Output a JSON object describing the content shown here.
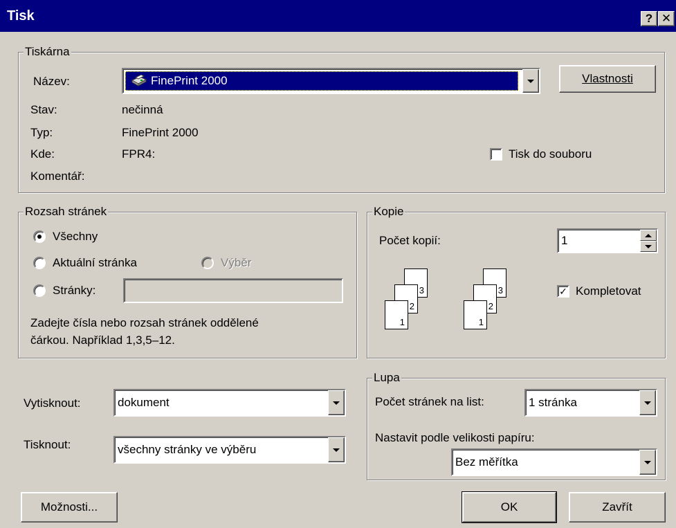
{
  "window": {
    "title": "Tisk",
    "help_button": "?",
    "close_button": "✕"
  },
  "printer": {
    "group_label": "Tiskárna",
    "name_label": "Název:",
    "name_value": "FinePrint 2000",
    "properties_button": "Vlastnosti",
    "status_label": "Stav:",
    "status_value": "nečinná",
    "type_label": "Typ:",
    "type_value": "FinePrint 2000",
    "where_label": "Kde:",
    "where_value": "FPR4:",
    "comment_label": "Komentář:",
    "print_to_file_label": "Tisk do souboru",
    "print_to_file_checked": false
  },
  "range": {
    "group_label": "Rozsah stránek",
    "all_label": "Všechny",
    "current_label": "Aktuální stránka",
    "selection_label": "Výběr",
    "pages_label": "Stránky:",
    "pages_value": "",
    "hint_line1": "Zadejte čísla nebo rozsah stránek oddělené",
    "hint_line2": "čárkou. Například 1,3,5–12.",
    "selected": "all"
  },
  "copies": {
    "group_label": "Kopie",
    "count_label": "Počet kopií:",
    "count_value": "1",
    "collate_label": "Kompletovat",
    "collate_checked": true,
    "page_numbers": [
      "1",
      "2",
      "3"
    ]
  },
  "print_what": {
    "label": "Vytisknout:",
    "value": "dokument"
  },
  "print_pages": {
    "label": "Tisknout:",
    "value": "všechny stránky ve výběru"
  },
  "zoom": {
    "group_label": "Lupa",
    "pages_per_sheet_label": "Počet stránek na list:",
    "pages_per_sheet_value": "1 stránka",
    "scale_label": "Nastavit podle velikosti papíru:",
    "scale_value": "Bez měřítka"
  },
  "buttons": {
    "options": "Možnosti...",
    "ok": "OK",
    "close": "Zavřít"
  }
}
